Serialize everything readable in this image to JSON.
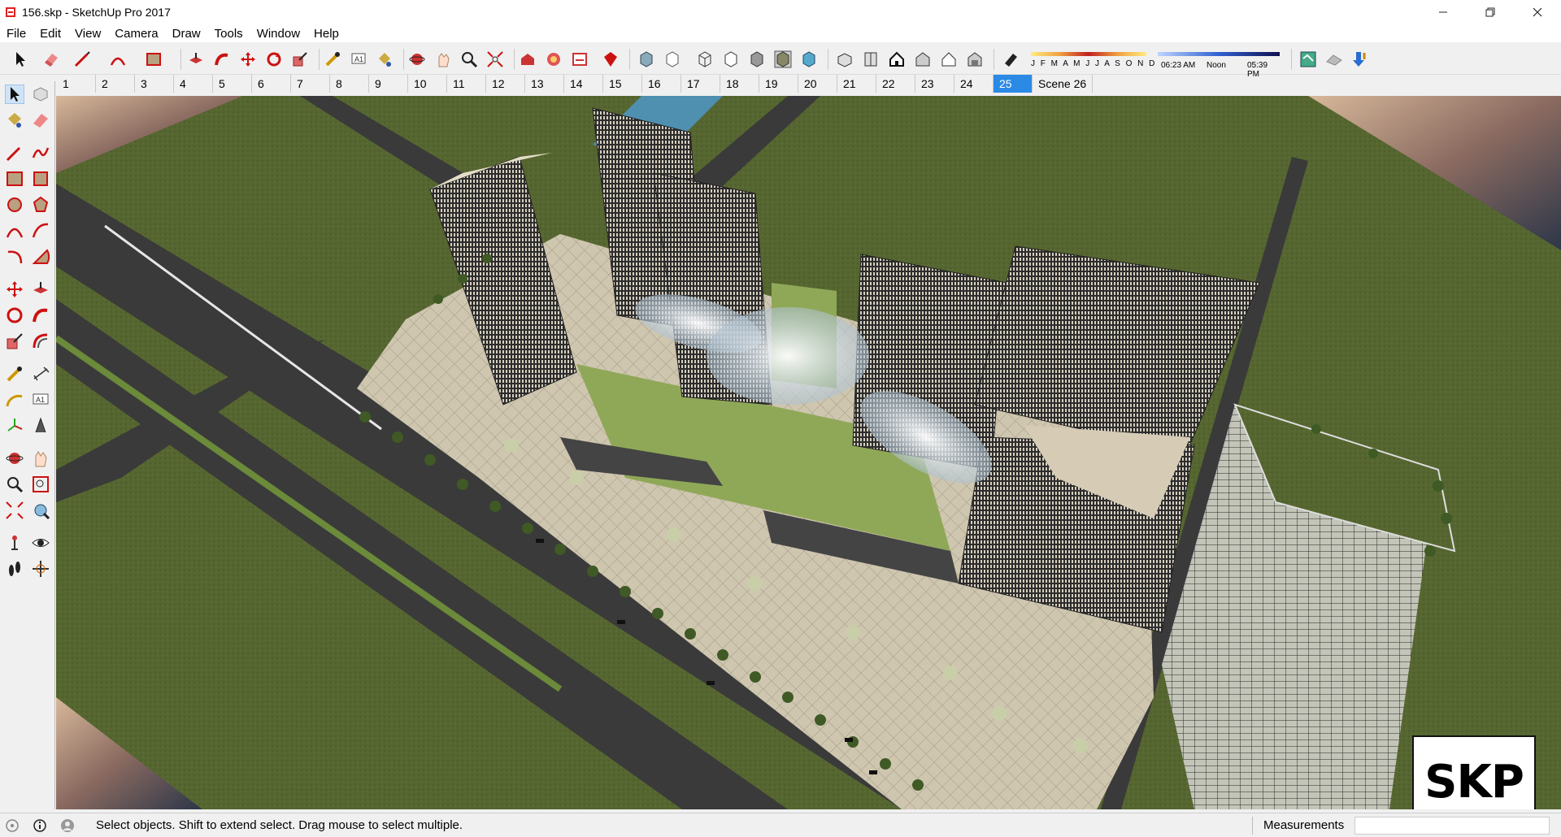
{
  "window": {
    "title": "156.skp - SketchUp Pro 2017",
    "controls": [
      "minimize",
      "maximize",
      "close"
    ]
  },
  "menu": [
    "File",
    "Edit",
    "View",
    "Camera",
    "Draw",
    "Tools",
    "Window",
    "Help"
  ],
  "shadow_settings": {
    "months": "J F M A M J J A S O N D",
    "time_start": "06:23 AM",
    "time_mid": "Noon",
    "time_end": "05:39 PM"
  },
  "scene_tabs": {
    "tabs": [
      "1",
      "2",
      "3",
      "4",
      "5",
      "6",
      "7",
      "8",
      "9",
      "10",
      "11",
      "12",
      "13",
      "14",
      "15",
      "16",
      "17",
      "18",
      "19",
      "20",
      "21",
      "22",
      "23",
      "24",
      "25",
      "Scene 26"
    ],
    "active_index": 24
  },
  "status": {
    "hint": "Select objects. Shift to extend select. Drag mouse to select multiple.",
    "measurements_label": "Measurements",
    "measurements_value": ""
  },
  "badge": {
    "text": "SKP"
  },
  "colors": {
    "accent": "#2a8ae6",
    "grass": "#55652f",
    "road": "#3a3a3a",
    "water": "#4f8fb0"
  }
}
